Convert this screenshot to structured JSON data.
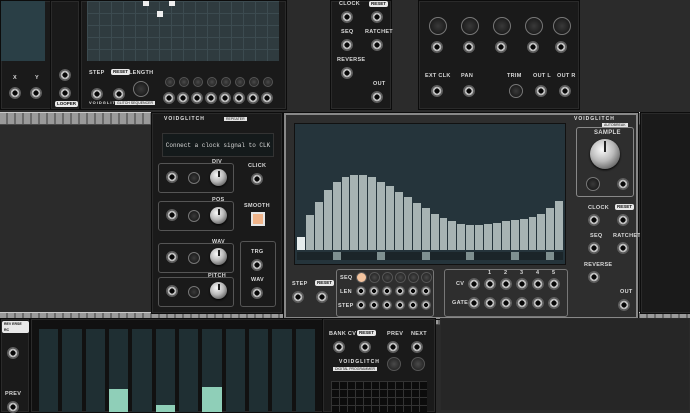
{
  "colors": {
    "screen_bg": "#24333a",
    "bar_fill": "#a7b3b3",
    "bar_active": "#e6eded",
    "accent_orange": "#e8a26a",
    "teal_bar": "#8fcfb8"
  },
  "top_left": {
    "x_label": "X",
    "y_label": "Y",
    "badge": "LOOPER"
  },
  "glitch_sequencer": {
    "step_label": "STEP",
    "reset_badge": "RESET",
    "length_label": "LENGTH",
    "brand": "VOIDGLITCH",
    "subtitle": "GLITCH SEQUENCER",
    "grid_cells_on": [
      [
        1,
        0
      ],
      [
        2,
        1
      ],
      [
        3,
        0
      ]
    ]
  },
  "clock_module": {
    "clock_label": "CLOCK",
    "reset_badge": "RESET",
    "seq_label": "SEQ",
    "ratchet_label": "RATCHET",
    "reverse_label": "REVERSE",
    "out_label": "OUT"
  },
  "sampler_top": {
    "ext_clk": "EXT CLK",
    "pan": "PAN",
    "trim": "TRIM",
    "out_l": "OUT L",
    "out_r": "OUT R"
  },
  "repeater": {
    "brand": "VOIDGLITCH",
    "subtitle": "REPEATER",
    "message": "Connect a clock signal to CLK",
    "div_label": "DIV",
    "pos_label": "POS",
    "wav_label": "WAV",
    "pitch_label": "PITCH",
    "click_label": "CLICK",
    "smooth_label": "SMOOTH",
    "trg_label": "TRG",
    "wav_out_label": "WAV"
  },
  "autobreak": {
    "brand": "VOIDGLITCH",
    "subtitle": "AUTOBREAK",
    "sample_label": "SAMPLE",
    "clock_label": "CLOCK",
    "reset_badge": "RESET",
    "seq_label": "SEQ",
    "ratchet_label": "RATCHET",
    "reverse_label": "REVERSE",
    "out_label": "OUT",
    "step_label": "STEP",
    "reset2_badge": "RESET",
    "seq_row": "SEQ",
    "len_row": "LEN",
    "step_row": "STEP",
    "cv_label": "CV",
    "gate_label": "GATE",
    "channel_numbers": [
      "1",
      "2",
      "3",
      "4",
      "5",
      "6"
    ],
    "waveform_levels": [
      0.12,
      0.32,
      0.44,
      0.55,
      0.62,
      0.66,
      0.68,
      0.68,
      0.66,
      0.62,
      0.58,
      0.53,
      0.48,
      0.43,
      0.38,
      0.33,
      0.29,
      0.26,
      0.24,
      0.23,
      0.23,
      0.24,
      0.25,
      0.26,
      0.27,
      0.28,
      0.3,
      0.33,
      0.38,
      0.45
    ],
    "active_bar": 0,
    "markers": [
      4,
      9,
      14,
      19,
      24,
      28
    ]
  },
  "bottom_left": {
    "badge": "REV ERSE RC",
    "prev_label": "PREV"
  },
  "digital_programmer": {
    "bank_cv": "BANK CV",
    "reset_badge": "RESET",
    "prev_label": "PREV",
    "next_label": "NEXT",
    "brand": "VOIDGLITCH",
    "subtitle": "DIGITAL PROGRAMMER",
    "slider_levels": [
      0,
      0,
      0,
      0.28,
      0,
      0.08,
      0,
      0.3,
      0,
      0,
      0,
      0
    ]
  }
}
